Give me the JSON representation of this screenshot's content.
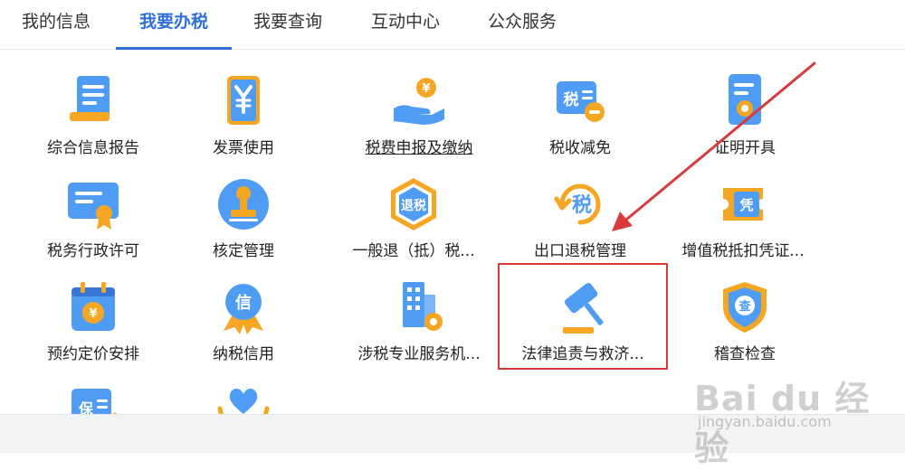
{
  "nav": {
    "tabs": [
      {
        "label": "我的信息"
      },
      {
        "label": "我要办税"
      },
      {
        "label": "我要查询"
      },
      {
        "label": "互动中心"
      },
      {
        "label": "公众服务"
      }
    ],
    "active_index": 1
  },
  "tiles": [
    {
      "label": "综合信息报告",
      "icon": "report-doc-icon"
    },
    {
      "label": "发票使用",
      "icon": "invoice-yen-icon"
    },
    {
      "label": "税费申报及缴纳",
      "icon": "coin-hand-icon"
    },
    {
      "label": "税收减免",
      "icon": "tax-reduce-icon"
    },
    {
      "label": "证明开具",
      "icon": "certificate-doc-icon"
    },
    {
      "label": "税务行政许可",
      "icon": "license-award-icon"
    },
    {
      "label": "核定管理",
      "icon": "stamp-icon"
    },
    {
      "label": "一般退（抵）税...",
      "icon": "refund-hexagon-icon"
    },
    {
      "label": "出口退税管理",
      "icon": "export-refund-icon"
    },
    {
      "label": "增值税抵扣凭证...",
      "icon": "voucher-ticket-icon"
    },
    {
      "label": "预约定价安排",
      "icon": "calendar-yen-icon"
    },
    {
      "label": "纳税信用",
      "icon": "credit-medal-icon"
    },
    {
      "label": "涉税专业服务机...",
      "icon": "building-gear-icon"
    },
    {
      "label": "法律追责与救济...",
      "icon": "gavel-icon"
    },
    {
      "label": "稽查检查",
      "icon": "inspection-shield-icon"
    },
    {
      "label": "",
      "icon": "insurance-doc-icon"
    },
    {
      "label": "",
      "icon": "heart-hands-icon"
    }
  ],
  "watermark": {
    "logo": "Bai du 经验",
    "url": "jingyan.baidu.com"
  },
  "colors": {
    "accent": "#2f6fd6",
    "icon_blue": "#3f8ef0",
    "icon_orange": "#f5a623",
    "highlight": "#d93a3a"
  }
}
